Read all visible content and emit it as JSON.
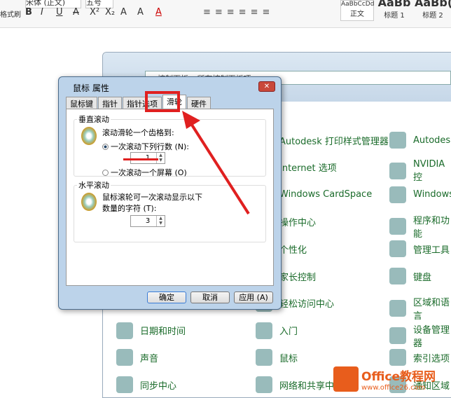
{
  "ribbon": {
    "font_name": "宋体 (正文)",
    "font_size": "五号",
    "format_painter": "格式刷",
    "format_buttons": [
      "B",
      "I",
      "U",
      "A",
      "X²",
      "X₂",
      "A",
      "A",
      "A"
    ],
    "styles": [
      {
        "preview": "AaBbCcDd",
        "label": "正文"
      },
      {
        "preview": "AaBb",
        "label": "标题 1"
      },
      {
        "preview": "AaBb(",
        "label": "标题 2"
      }
    ]
  },
  "control_panel": {
    "breadcrumb": [
      "控制面板",
      "所有控制面板项"
    ],
    "items": [
      [
        "日期和时间",
        "声音",
        "同步中心"
      ],
      [
        "Autodesk 打印样式管理器",
        "Internet 选项",
        "Windows CardSpace",
        "操作中心",
        "个性化",
        "家长控制",
        "轻松访问中心",
        "入门",
        "鼠标",
        "网络和共享中心"
      ],
      [
        "Autodesk",
        "NVIDIA 控",
        "Windows",
        "程序和功能",
        "管理工具",
        "键盘",
        "区域和语言",
        "设备管理器",
        "索引选项",
        "通知区域"
      ]
    ]
  },
  "dialog": {
    "title": "鼠标 属性",
    "close": "✕",
    "tabs": [
      "鼠标键",
      "指针",
      "指针选项",
      "滑轮",
      "硬件"
    ],
    "vertical": {
      "label": "垂直滚动",
      "prompt": "滚动滑轮一个齿格到:",
      "option1": "一次滚动下列行数 (N):",
      "lines": "1",
      "option2": "一次滚动一个屏幕 (O)"
    },
    "horizontal": {
      "label": "水平滚动",
      "prompt": "鼠标滚轮可一次滚动显示以下数量的字符 (T):",
      "chars": "3"
    },
    "buttons": {
      "ok": "确定",
      "cancel": "取消",
      "apply": "应用 (A)"
    }
  },
  "watermark": {
    "brand": "Office教程网",
    "url": "www.office26.com"
  },
  "annotation_color": "#e02020"
}
